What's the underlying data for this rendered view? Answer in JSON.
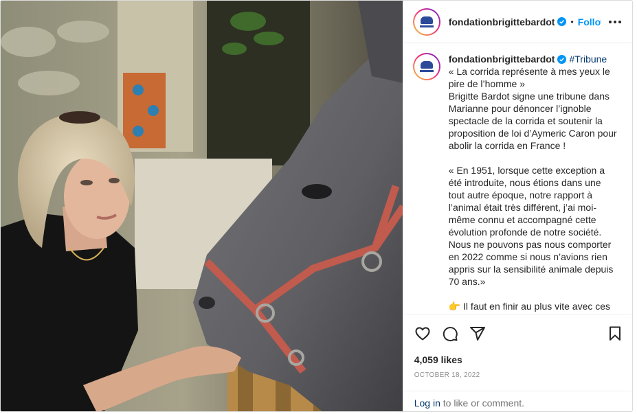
{
  "account": {
    "username": "fondationbrigittebardot",
    "follow_label": "Follow",
    "separator": "•"
  },
  "caption": {
    "hashtag": "#Tribune",
    "lines": [
      "« La corrida représente à mes yeux le pire de l’homme »",
      "Brigitte Bardot signe une tribune dans Marianne pour dénoncer l’ignoble spectacle de la corrida et soutenir la proposition de loi d’Aymeric Caron pour abolir la corrida en France !",
      "« En 1951, lorsque cette exception a été introduite, nous étions dans une tout autre époque, notre rapport à l’animal était très différent, j’ai moi-même connu et accompagné cette évolution profonde de notre société. Nous ne pouvons pas nous comporter en 2022 comme si nous n’avions rien appris sur la sensibilité animale depuis 70 ans.»",
      "👉 Il faut en finir au plus vite avec ces"
    ]
  },
  "stats": {
    "likes": "4,059 likes",
    "date": "October 18, 2022"
  },
  "login": {
    "link": "Log in",
    "rest": " to like or comment."
  },
  "icons": [
    "like-icon",
    "comment-icon",
    "share-icon",
    "save-icon",
    "more-options-icon",
    "verified-badge-icon"
  ],
  "colors": {
    "link_blue": "#0095f6",
    "hashtag_blue": "#00376b",
    "muted": "#737373"
  }
}
